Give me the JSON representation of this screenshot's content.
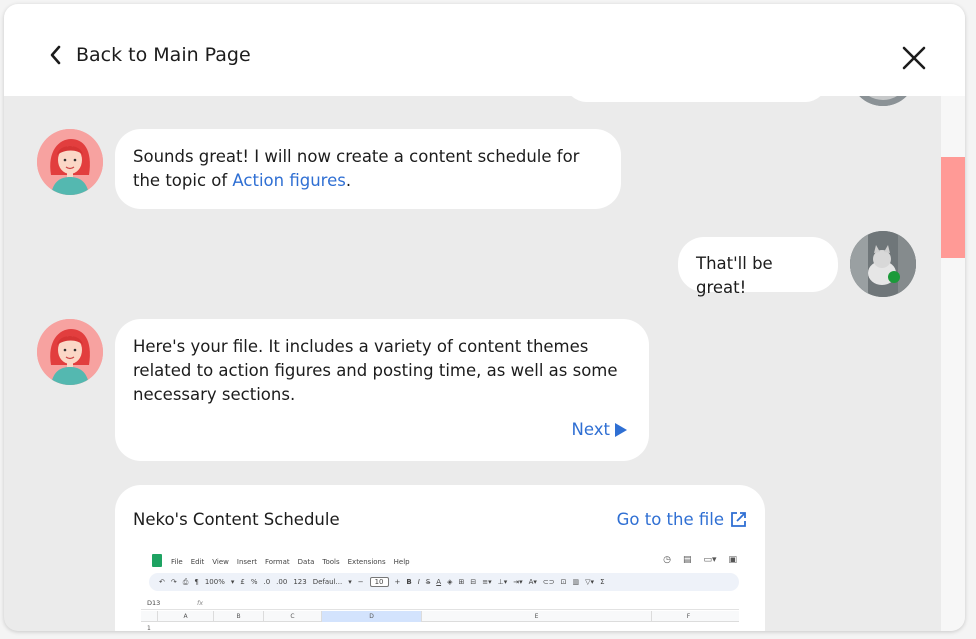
{
  "header": {
    "back_label": "Back to Main Page"
  },
  "messages": {
    "bot1_text": "Sounds great! I will now create a content schedule for the topic of ",
    "bot1_link": "Action figures",
    "bot1_suffix": ".",
    "user1_text": "That'll be great!",
    "bot2_text": "Here's your file. It includes a variety of content themes related to action figures and posting time, as well as some necessary sections.",
    "bot2_next": "Next"
  },
  "file_card": {
    "title": "Neko's Content Schedule",
    "goto_label": "Go to the file"
  },
  "sheet_preview": {
    "menu": [
      "File",
      "Edit",
      "View",
      "Insert",
      "Format",
      "Data",
      "Tools",
      "Extensions",
      "Help"
    ],
    "toolbar": {
      "zoom": "100%",
      "currency": "£",
      "percent": "%",
      "dec_dec": ".0",
      "dec_inc": ".00",
      "num_fmt": "123",
      "font": "Defaul...",
      "font_size": "10"
    },
    "cell_ref": "D13",
    "fx": "fx",
    "columns": [
      "A",
      "B",
      "C",
      "D",
      "E",
      "F"
    ],
    "row_1": "1"
  },
  "colors": {
    "accent_link": "#2f6fd3",
    "scroll_thumb": "#ff9a96",
    "chat_bg": "#ebebeb",
    "bot_avatar_bg": "#f7a2a0"
  }
}
